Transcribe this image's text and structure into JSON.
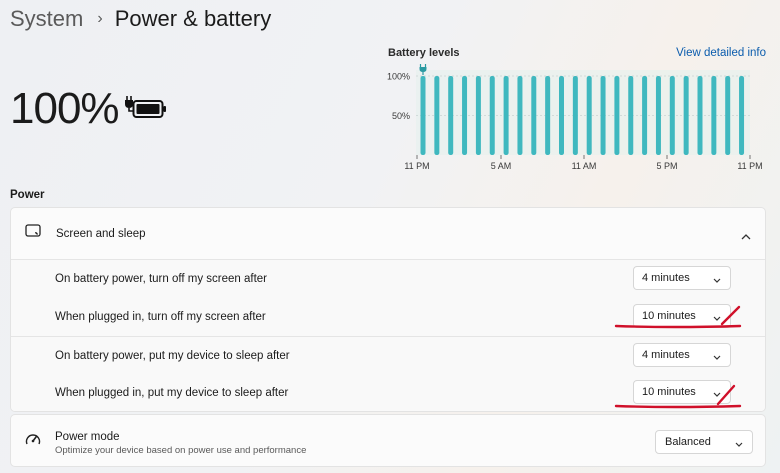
{
  "breadcrumb": {
    "parent": "System",
    "separator": "›",
    "current": "Power & battery"
  },
  "battery": {
    "percent_text": "100%",
    "icon": "battery-charging-icon"
  },
  "chart_data": {
    "type": "bar",
    "title": "Battery levels",
    "link": "View detailed info",
    "y_ticks": [
      "100%",
      "50%"
    ],
    "x_ticks": [
      "11 PM",
      "5 AM",
      "11 AM",
      "5 PM",
      "11 PM"
    ],
    "ylim": [
      0,
      100
    ],
    "values": [
      100,
      100,
      100,
      100,
      100,
      100,
      100,
      100,
      100,
      100,
      100,
      100,
      100,
      100,
      100,
      100,
      100,
      100,
      100,
      100,
      100,
      100,
      100,
      100
    ],
    "bar_color": "#3fb8bf",
    "charging_marker": "plug-icon"
  },
  "power_section_label": "Power",
  "screen_sleep": {
    "title": "Screen and sleep",
    "icon": "screen-sleep-icon",
    "rows": [
      {
        "label": "On battery power, turn off my screen after",
        "value": "4 minutes"
      },
      {
        "label": "When plugged in, turn off my screen after",
        "value": "10 minutes"
      },
      {
        "label": "On battery power, put my device to sleep after",
        "value": "4 minutes"
      },
      {
        "label": "When plugged in, put my device to sleep after",
        "value": "10 minutes"
      }
    ]
  },
  "power_mode": {
    "title": "Power mode",
    "subtitle": "Optimize your device based on power use and performance",
    "value": "Balanced",
    "icon": "power-mode-gauge-icon"
  },
  "colors": {
    "accent_link": "#0b5cad",
    "bar": "#3fb8bf",
    "annotation": "#d0102a"
  }
}
